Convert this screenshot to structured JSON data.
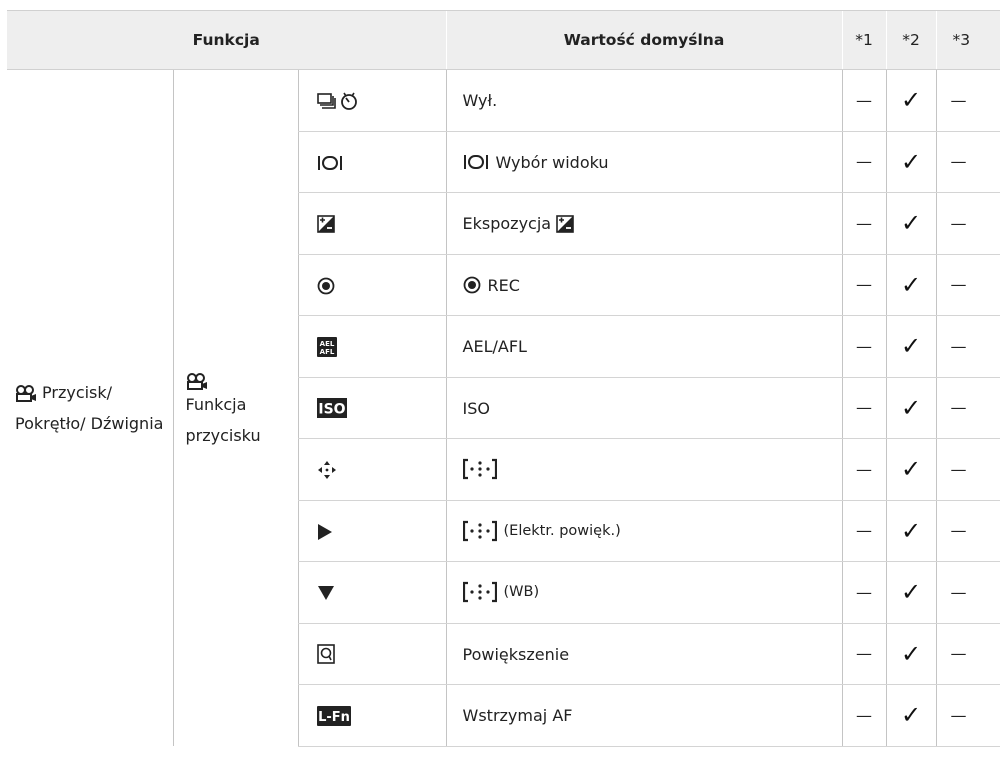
{
  "header": {
    "col_function": "Funkcja",
    "col_default": "Wartość domyślna",
    "col_1": "*1",
    "col_2": "*2",
    "col_3": "*3"
  },
  "group": {
    "level1_label": "Przycisk/ Pokrętło/ Dźwignia",
    "level1_icon": "movie-camera-icon",
    "level2_label": "Funkcja przycisku",
    "level2_icon": "movie-camera-icon"
  },
  "rows": [
    {
      "icon": "drive-self-timer-icon",
      "value": "Wył.",
      "c1": "—",
      "c2": "✓",
      "c3": "—"
    },
    {
      "icon": "view-selection-icon",
      "value": "Wybór widoku",
      "value_icon": "view-selection-icon",
      "c1": "—",
      "c2": "✓",
      "c3": "—"
    },
    {
      "icon": "exposure-compensation-icon",
      "value": "Ekspozycja",
      "value_icon_after": "exposure-compensation-icon",
      "c1": "—",
      "c2": "✓",
      "c3": "—"
    },
    {
      "icon": "record-icon",
      "value": "REC",
      "value_icon": "record-icon",
      "c1": "—",
      "c2": "✓",
      "c3": "—"
    },
    {
      "icon": "ael-afl-icon",
      "value": "AEL/AFL",
      "c1": "—",
      "c2": "✓",
      "c3": "—"
    },
    {
      "icon": "iso-icon",
      "value": "ISO",
      "c1": "—",
      "c2": "✓",
      "c3": "—"
    },
    {
      "icon": "four-arrows-icon",
      "value": "",
      "value_icon": "af-target-icon",
      "c1": "—",
      "c2": "✓",
      "c3": "—"
    },
    {
      "icon": "play-triangle-icon",
      "value": "(Elektr. powięk.)",
      "value_icon": "af-target-icon",
      "c1": "—",
      "c2": "✓",
      "c3": "—"
    },
    {
      "icon": "down-triangle-icon",
      "value": "(WB)",
      "value_icon": "af-target-icon",
      "c1": "—",
      "c2": "✓",
      "c3": "—"
    },
    {
      "icon": "magnify-frame-icon",
      "value": "Powiększenie",
      "c1": "—",
      "c2": "✓",
      "c3": "—"
    },
    {
      "icon": "l-fn-icon",
      "value": "Wstrzymaj AF",
      "c1": "—",
      "c2": "✓",
      "c3": "—"
    }
  ]
}
